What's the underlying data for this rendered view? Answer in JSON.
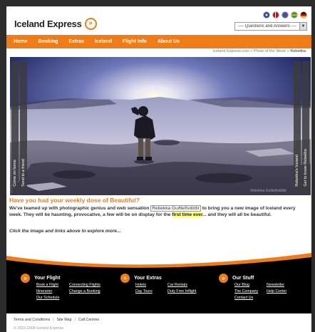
{
  "logo": {
    "text": "Iceland Express",
    "mark": "»"
  },
  "flags": [
    {
      "name": "uk-flag",
      "color": "#2a4f9c"
    },
    {
      "name": "danish-flag",
      "color": "#c8102e"
    },
    {
      "name": "uk-flag-2",
      "color": "#3b5ba8"
    },
    {
      "name": "swedish-flag",
      "color": "#5a8f2b"
    },
    {
      "name": "german-flag",
      "color": "#d9a300"
    }
  ],
  "qa_select": {
    "value": "---- Questions and Answers ----"
  },
  "nav": {
    "items": [
      "Home",
      "Booking",
      "Extras",
      "Iceland",
      "Flight Info",
      "About Us"
    ]
  },
  "breadcrumb": {
    "items": [
      "Iceland Express.com",
      "Photo of the Week"
    ],
    "current": "Rebekka",
    "sep": "»"
  },
  "hero": {
    "left_tabs": [
      "Come on home",
      "Send to a friend"
    ],
    "right_tabs": [
      "Rebekka's Iceland",
      "Get to know Rebekka"
    ],
    "watermark": "Rebekka Guðleifsdóttir"
  },
  "content": {
    "headline": "Have you had your weekly dose of Beautiful?",
    "p1": "We've teamed up with photographic genius and web sensation ",
    "name": "Rebekka Guðleifsdóttir",
    "p2": " to bring you a new image of Iceland every week. They will be haunting, provocative, a few will be on display for the ",
    "highlight": "first time ever",
    "p3": "... and they will all be beautiful.",
    "click_line": "Click the image and links above to explore more..."
  },
  "footer": {
    "columns": [
      {
        "title": "Your Flight",
        "icon": "»",
        "links_a": [
          "Book a Flight",
          "Itinerarier",
          "Our Schedule"
        ],
        "links_b": [
          "Connecting Flights",
          "Change a Booking"
        ]
      },
      {
        "title": "Your Extras",
        "icon": "+",
        "links_a": [
          "Hotels",
          "Day Tours"
        ],
        "links_b": [
          "Car Rentals",
          "Duty Free Inflight"
        ]
      },
      {
        "title": "Our Stuff",
        "icon": "»",
        "links_a": [
          "Our Blog",
          "The Company",
          "Contact Us"
        ],
        "links_b": [
          "Newsletter",
          "Help Center"
        ]
      }
    ]
  },
  "legal": {
    "links": [
      "Terms and Conditions",
      "Site Map",
      "Call Centres"
    ],
    "copyright": "© 2003-2008 Iceland Express"
  },
  "colors": {
    "accent": "#f07c18",
    "footer_bg": "#000000",
    "page_bg": "#2b2b2b"
  }
}
